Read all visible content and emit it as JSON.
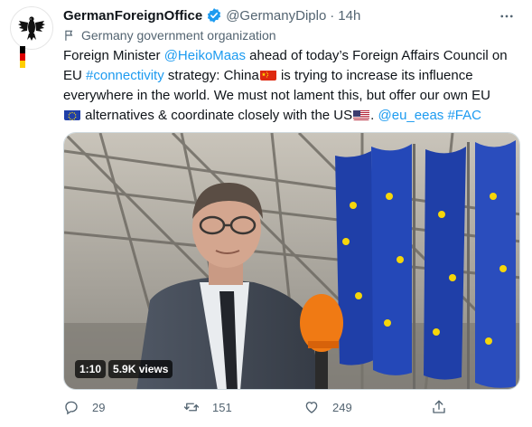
{
  "author": {
    "display_name": "GermanForeignOffice",
    "handle": "@GermanyDiplo",
    "separator": "·",
    "time": "14h",
    "org_label": "Germany government organization",
    "avatar_icon": "federal-eagle-icon",
    "verified_icon": "verified-badge-icon"
  },
  "tweet": {
    "l1_a": "Foreign Minister ",
    "l1_mention": "@HeikoMaas",
    "l1_b": " ahead of today’s Foreign Affairs Council on",
    "l2_a": "EU ",
    "l2_hashtag": "#connectivity",
    "l2_b": " strategy: China",
    "l2_c": " is trying to increase its influence",
    "l3": "everywhere in the world. We must not lament this, but offer our own EU",
    "l4_a": " alternatives & coordinate closely with the US",
    "l4_mention": "@eu_eeas",
    "l4_hashtag": "#FAC",
    "emoji": [
      "china-flag",
      "eu-flag",
      "us-flag"
    ]
  },
  "media": {
    "duration": "1:10",
    "views": "5.9K views"
  },
  "actions": {
    "replies": "29",
    "retweets": "151",
    "likes": "249"
  },
  "colors": {
    "link": "#1d9bf0",
    "verified": "#1d9bf0",
    "muted": "#536471",
    "eu_blue": "#1f3fa8",
    "eu_star": "#f5d60a",
    "mic_orange": "#f07a14"
  }
}
